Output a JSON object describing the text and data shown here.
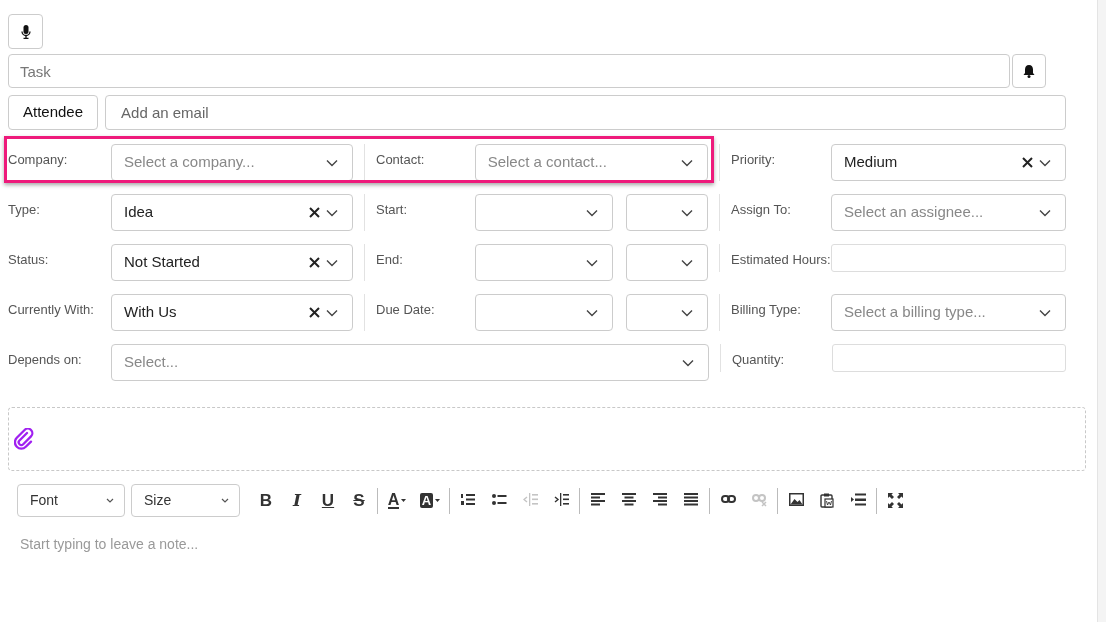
{
  "task_field": {
    "placeholder": "Task"
  },
  "attendee": {
    "button": "Attendee",
    "placeholder": "Add an email"
  },
  "rows": [
    {
      "highlighted": true,
      "cells": [
        {
          "label": "Company:",
          "kind": "select",
          "placeholder": "Select a company..."
        },
        {
          "label": "Contact:",
          "kind": "select",
          "placeholder": "Select a contact..."
        },
        {
          "label": "Priority:",
          "kind": "select",
          "value": "Medium",
          "clearable": true
        }
      ]
    },
    {
      "highlighted": false,
      "cells": [
        {
          "label": "Type:",
          "kind": "select",
          "value": "Idea",
          "clearable": true
        },
        {
          "label": "Start:",
          "kind": "datetime"
        },
        {
          "label": "Assign To:",
          "kind": "select",
          "placeholder": "Select an assignee..."
        }
      ]
    },
    {
      "highlighted": false,
      "cells": [
        {
          "label": "Status:",
          "kind": "select",
          "value": "Not Started",
          "clearable": true
        },
        {
          "label": "End:",
          "kind": "datetime"
        },
        {
          "label": "Estimated Hours:",
          "kind": "input"
        }
      ]
    },
    {
      "highlighted": false,
      "cells": [
        {
          "label": "Currently With:",
          "kind": "select",
          "value": "With Us",
          "clearable": true
        },
        {
          "label": "Due Date:",
          "kind": "datetime"
        },
        {
          "label": "Billing Type:",
          "kind": "select",
          "placeholder": "Select a billing type..."
        }
      ]
    },
    {
      "highlighted": false,
      "cells": [
        {
          "label": "Depends on:",
          "kind": "wideselect",
          "placeholder": "Select..."
        },
        {
          "label": "Quantity:",
          "kind": "input"
        }
      ]
    }
  ],
  "editor": {
    "font": "Font",
    "size": "Size",
    "placeholder": "Start typing to leave a note...",
    "toolbar": [
      [
        {
          "kind": "bold",
          "label": "B",
          "disabled": false
        },
        {
          "kind": "italic",
          "label": "I",
          "disabled": false
        },
        {
          "kind": "underline",
          "label": "U",
          "disabled": false
        },
        {
          "kind": "strike",
          "label": "S",
          "disabled": false
        }
      ],
      [
        {
          "kind": "forecolor",
          "label": "A",
          "disabled": false
        },
        {
          "kind": "backcolor",
          "label": "A",
          "disabled": false
        }
      ],
      [
        {
          "kind": "ol",
          "disabled": false
        },
        {
          "kind": "ul",
          "disabled": false
        },
        {
          "kind": "outdent",
          "disabled": true
        },
        {
          "kind": "indent",
          "disabled": false
        }
      ],
      [
        {
          "kind": "align-left",
          "disabled": false
        },
        {
          "kind": "align-center",
          "disabled": false
        },
        {
          "kind": "align-right",
          "disabled": false
        },
        {
          "kind": "justify",
          "disabled": false
        }
      ],
      [
        {
          "kind": "link",
          "disabled": false
        },
        {
          "kind": "unlink",
          "disabled": true
        }
      ],
      [
        {
          "kind": "image",
          "disabled": false
        },
        {
          "kind": "paste",
          "disabled": false
        },
        {
          "kind": "hr",
          "disabled": false
        }
      ],
      [
        {
          "kind": "fullscreen",
          "disabled": false
        }
      ]
    ]
  }
}
